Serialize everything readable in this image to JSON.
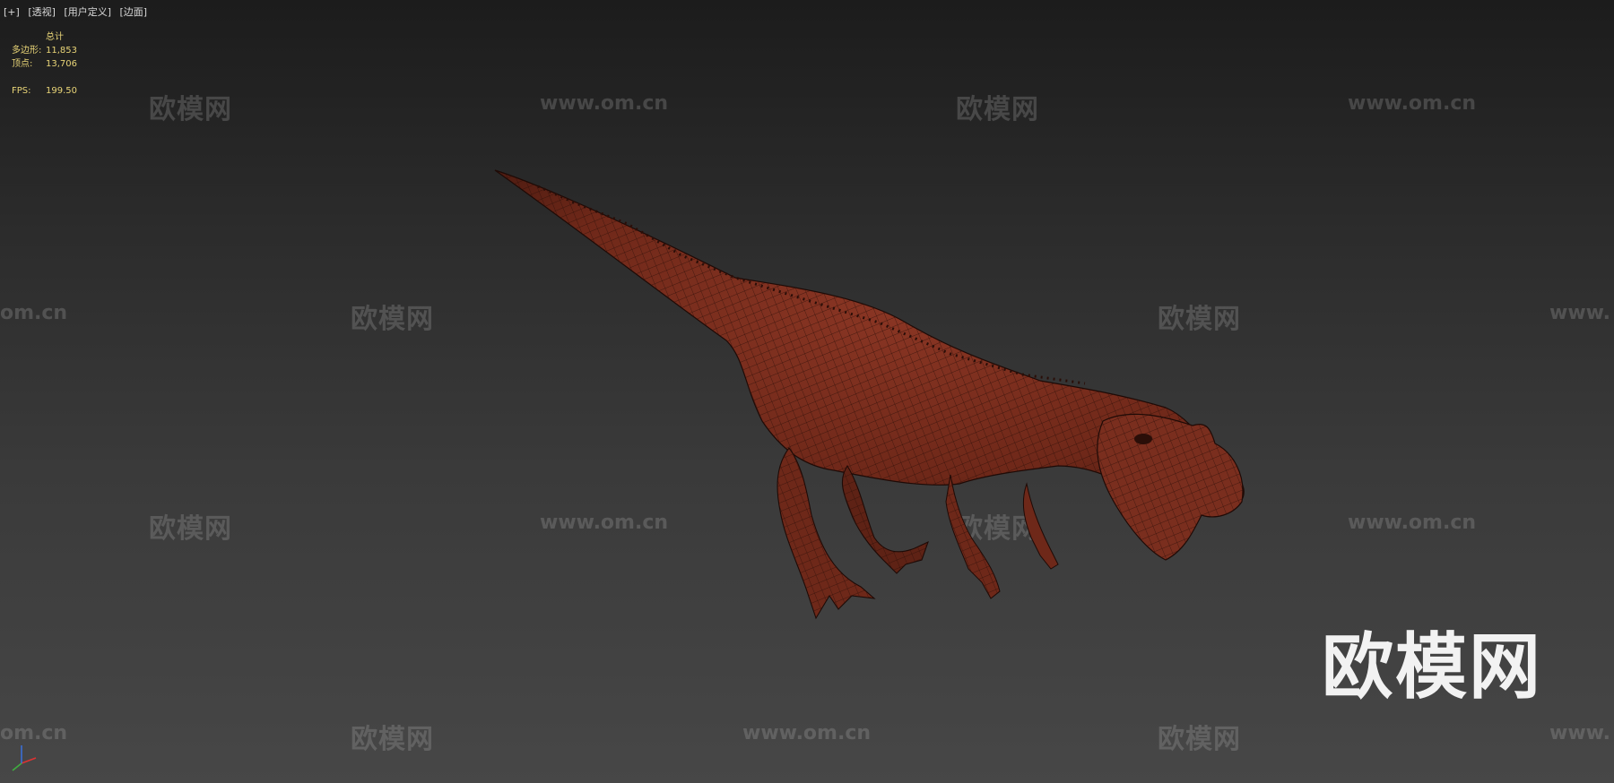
{
  "viewport": {
    "labels": [
      "[+]",
      "[透视]",
      "[用户定义]",
      "[边面]"
    ]
  },
  "stats": {
    "header": "总计",
    "polygons_label": "多边形:",
    "polygons_value": "11,853",
    "vertices_label": "顶点:",
    "vertices_value": "13,706",
    "fps_label": "FPS:",
    "fps_value": "199.50"
  },
  "watermarks": {
    "cn": "欧模网",
    "url": "www.om.cn",
    "url_partial": "om.cn",
    "url_cut": "www.",
    "big_logo": "欧模网"
  },
  "colors": {
    "model": "#7a2e1e",
    "wire": "#2a0e08",
    "stats_text": "#e8d477"
  },
  "icons": {
    "axis": "xyz-axis-gizmo-icon"
  }
}
